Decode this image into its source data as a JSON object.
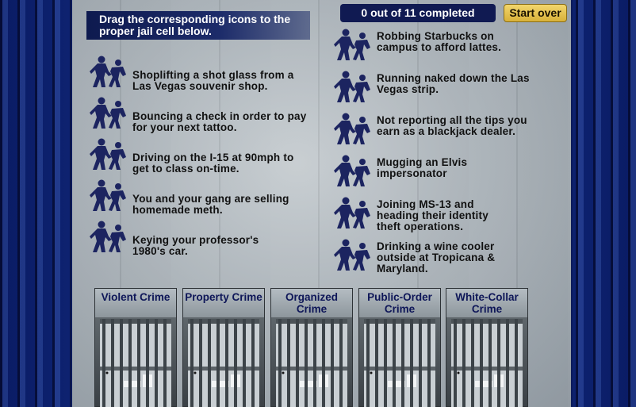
{
  "instructions": "Drag the corresponding icons to the proper jail cell below.",
  "progress": {
    "text": "0 out of 11 completed",
    "completed": 0,
    "total": 11
  },
  "start_over_label": "Start over",
  "crimes_left": [
    {
      "text": "Shoplifting a shot glass from a Las Vegas souvenir shop."
    },
    {
      "text": "Bouncing a check in order to pay for your next tattoo."
    },
    {
      "text": "Driving on the I-15 at 90mph to get to class on-time."
    },
    {
      "text": "You and your gang are selling homemade meth."
    },
    {
      "text": "Keying your professor's 1980's car."
    }
  ],
  "crimes_right": [
    {
      "text": "Robbing Starbucks on campus to afford lattes."
    },
    {
      "text": "Running naked down the Las Vegas strip."
    },
    {
      "text": "Not reporting all the tips you earn as a blackjack dealer."
    },
    {
      "text": "Mugging an Elvis impersonator"
    },
    {
      "text": "Joining MS-13 and heading their identity theft operations."
    },
    {
      "text": "Drinking a wine cooler outside at Tropicana & Maryland."
    }
  ],
  "cells": [
    {
      "label": "Violent Crime"
    },
    {
      "label": "Property Crime"
    },
    {
      "label": "Organized Crime"
    },
    {
      "label": "Public-Order Crime"
    },
    {
      "label": "White-Collar Crime"
    }
  ],
  "icons": {
    "crime_item": "police-arrest-icon",
    "cell": "jail-cell-icon"
  },
  "colors": {
    "instruction_bg": "#101a52",
    "start_over": "#e6c34c",
    "cell_label": "#0e1658"
  }
}
